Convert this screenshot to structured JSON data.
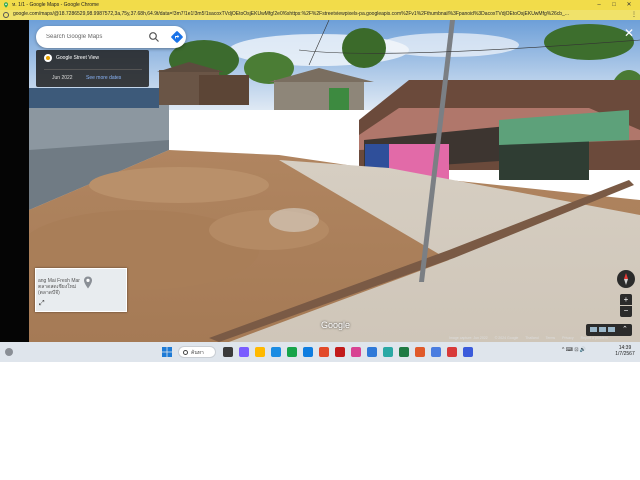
{
  "window": {
    "title": "ห. 1/1 - Google Maps - Google Chrome",
    "minimize": "–",
    "maximize": "□",
    "close": "✕"
  },
  "address_bar": {
    "url": "google.com/maps/@18.7286529,98.9987572,3a,75y,37.68h,64.9t/data=!3m7!1e1!3m5!1sacoxTVdjOEtoOsjEKUwMfg!2e0!6shttps:%2F%2Fstreetviewpixels-pa.googleapis.com%2Fv1%2Fthumbnail%3Fpanoid%3DacoxTVdjOEtoOsjEKUwMfg%26cb_..."
  },
  "maps": {
    "search_placeholder": "Search Google Maps",
    "streetview_title": "Google Street View",
    "capture_date": "Jun 2022",
    "see_more_dates": "See more dates",
    "minimap_label": "ang Mai Fresh Mar ตลาดสดเชียงใหม่ (ตลาดบีจี)",
    "google_logo": "Google",
    "zoom_in": "+",
    "zoom_out": "−",
    "close": "✕",
    "attribution": [
      "Image capture: Jun 2022",
      "© 2024 Google",
      "Thailand",
      "Terms",
      "Privacy",
      "Report a problem"
    ]
  },
  "taskbar": {
    "search_label": "ค้นหา",
    "tray": "^  ⌨  ⊡  🔊",
    "time": "14:39",
    "date": "1/7/2567",
    "app_colors": [
      "#3b3b3b",
      "#7a5cff",
      "#ffb900",
      "#1b8ce3",
      "#17a44a",
      "#0f7de0",
      "#e24a2a",
      "#c21b1b",
      "#d84393",
      "#2f79d8",
      "#2aa8a4",
      "#1f7a44",
      "#e05a2b",
      "#4a7de0",
      "#d83a3a",
      "#3b5bdb"
    ]
  }
}
